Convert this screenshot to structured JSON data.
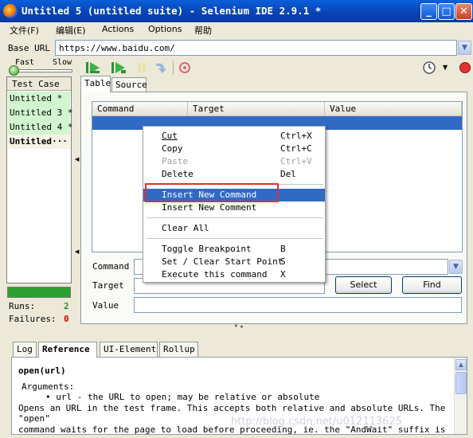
{
  "window": {
    "title": "Untitled 5 (untitled suite) - Selenium IDE 2.9.1 *"
  },
  "menu": [
    "文件(F)",
    "编辑(E)",
    "Actions",
    "Options",
    "帮助"
  ],
  "base_url": {
    "label": "Base URL",
    "value": "https://www.baidu.com/"
  },
  "speed": {
    "fast": "Fast",
    "slow": "Slow"
  },
  "test_cases": {
    "header": "Test Case",
    "items": [
      {
        "label": "Untitled *",
        "active": false
      },
      {
        "label": "Untitled 3 *",
        "active": false
      },
      {
        "label": "Untitled 4 *",
        "active": false
      },
      {
        "label": "Untitled···",
        "active": true
      }
    ]
  },
  "stats": {
    "runs_label": "Runs:",
    "runs": "2",
    "failures_label": "Failures:",
    "failures": "0"
  },
  "editor_tabs": [
    "Table",
    "Source"
  ],
  "table": {
    "columns": [
      "Command",
      "Target",
      "Value"
    ]
  },
  "command_form": {
    "command_label": "Command",
    "target_label": "Target",
    "value_label": "Value",
    "select_button": "Select",
    "find_button": "Find"
  },
  "context_menu": {
    "items": [
      {
        "label": "Cut",
        "shortcut": "Ctrl+X",
        "disabled": false
      },
      {
        "label": "Copy",
        "shortcut": "Ctrl+C",
        "disabled": false
      },
      {
        "label": "Paste",
        "shortcut": "Ctrl+V",
        "disabled": true
      },
      {
        "label": "Delete",
        "shortcut": "Del",
        "disabled": false
      },
      {
        "label": "Insert New Command",
        "shortcut": "",
        "highlighted": true
      },
      {
        "label": "Insert New Comment",
        "shortcut": ""
      },
      {
        "label": "Clear All",
        "shortcut": ""
      },
      {
        "label": "Toggle Breakpoint",
        "shortcut": "B"
      },
      {
        "label": "Set / Clear Start Point",
        "shortcut": "S"
      },
      {
        "label": "Execute this command",
        "shortcut": "X"
      }
    ]
  },
  "bottom_tabs": [
    "Log",
    "Reference",
    "UI-Element",
    "Rollup"
  ],
  "reference": {
    "signature": "open(url)",
    "arguments_label": "Arguments:",
    "argument": "url - the URL to open; may be relative or absolute",
    "line1": "Opens an URL in the test frame. This accepts both relative and absolute URLs. The \"open\"",
    "line2": "command waits for the page to load before proceeding, ie. the \"AndWait\" suffix is"
  },
  "watermark": "http://blog.csdn.net/u012113625",
  "colors": {
    "title_bar": "#0842b4",
    "selection": "#316ac5",
    "test_case_bg": "#d2f5cf",
    "progress": "#2da02d",
    "runs": "#2b8f2b",
    "failures": "#d40000",
    "annotation": "#e03030"
  }
}
